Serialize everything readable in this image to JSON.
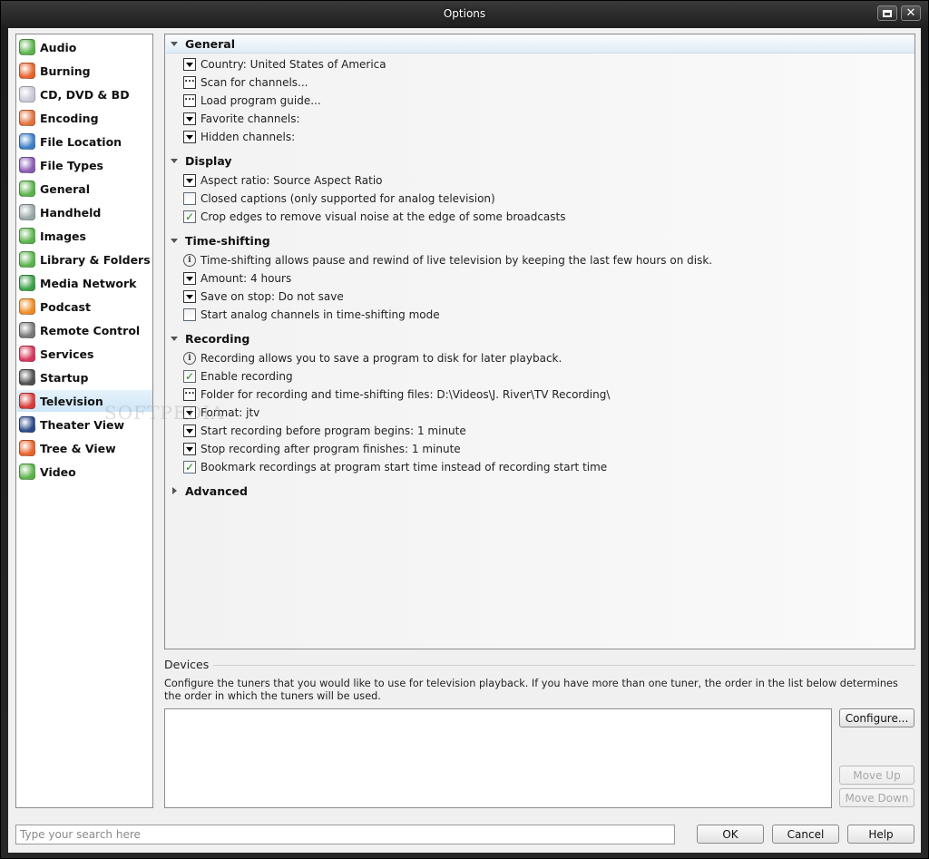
{
  "window": {
    "title": "Options"
  },
  "sidebar": {
    "items": [
      {
        "label": "Audio",
        "icon": "audio-icon",
        "color": "#5ab34a"
      },
      {
        "label": "Burning",
        "icon": "burning-icon",
        "color": "#e8632a"
      },
      {
        "label": "CD, DVD & BD",
        "icon": "disc-icon",
        "color": "#c8c8d8"
      },
      {
        "label": "Encoding",
        "icon": "encoding-icon",
        "color": "#e2703a"
      },
      {
        "label": "File Location",
        "icon": "globe-icon",
        "color": "#3a7fc8"
      },
      {
        "label": "File Types",
        "icon": "puzzle-icon",
        "color": "#8a5bb8"
      },
      {
        "label": "General",
        "icon": "general-icon",
        "color": "#5ab34a"
      },
      {
        "label": "Handheld",
        "icon": "handheld-icon",
        "color": "#9aa6a8"
      },
      {
        "label": "Images",
        "icon": "images-icon",
        "color": "#5ab34a"
      },
      {
        "label": "Library & Folders",
        "icon": "library-icon",
        "color": "#5ab34a"
      },
      {
        "label": "Media Network",
        "icon": "network-icon",
        "color": "#3aa048"
      },
      {
        "label": "Podcast",
        "icon": "rss-icon",
        "color": "#f08a24"
      },
      {
        "label": "Remote Control",
        "icon": "remote-icon",
        "color": "#777777"
      },
      {
        "label": "Services",
        "icon": "services-icon",
        "color": "#d8365a"
      },
      {
        "label": "Startup",
        "icon": "startup-icon",
        "color": "#505050"
      },
      {
        "label": "Television",
        "icon": "television-icon",
        "color": "#d83a3a",
        "active": true
      },
      {
        "label": "Theater View",
        "icon": "theater-icon",
        "color": "#2a4a8a"
      },
      {
        "label": "Tree & View",
        "icon": "tree-icon",
        "color": "#e8632a"
      },
      {
        "label": "Video",
        "icon": "video-icon",
        "color": "#5ab34a"
      }
    ]
  },
  "groups": [
    {
      "label": "General",
      "expanded": true,
      "options": [
        {
          "type": "dropdown",
          "label": "Country: United States of America"
        },
        {
          "type": "dots",
          "label": "Scan for channels..."
        },
        {
          "type": "dots",
          "label": "Load program guide..."
        },
        {
          "type": "dropdown",
          "label": "Favorite channels:"
        },
        {
          "type": "dropdown",
          "label": "Hidden channels:"
        }
      ]
    },
    {
      "label": "Display",
      "expanded": true,
      "options": [
        {
          "type": "dropdown",
          "label": "Aspect ratio: Source Aspect Ratio"
        },
        {
          "type": "checkbox",
          "checked": false,
          "label": "Closed captions (only supported for analog television)"
        },
        {
          "type": "checkbox",
          "checked": true,
          "label": "Crop edges to remove visual noise at the edge of some broadcasts"
        }
      ]
    },
    {
      "label": "Time-shifting",
      "expanded": true,
      "options": [
        {
          "type": "info",
          "label": "Time-shifting allows pause and rewind of live television by keeping the last few hours on disk."
        },
        {
          "type": "dropdown",
          "label": "Amount: 4 hours"
        },
        {
          "type": "dropdown",
          "label": "Save on stop: Do not save"
        },
        {
          "type": "checkbox",
          "checked": false,
          "label": "Start analog channels in time-shifting mode"
        }
      ]
    },
    {
      "label": "Recording",
      "expanded": true,
      "options": [
        {
          "type": "info",
          "label": "Recording allows you to save a program to disk for later playback."
        },
        {
          "type": "checkbox",
          "checked": true,
          "label": "Enable recording"
        },
        {
          "type": "dots",
          "label": "Folder for recording and time-shifting files: D:\\Videos\\J. River\\TV Recording\\"
        },
        {
          "type": "dropdown",
          "label": "Format: jtv"
        },
        {
          "type": "dropdown",
          "label": "Start recording before program begins: 1 minute"
        },
        {
          "type": "dropdown",
          "label": "Stop recording after program finishes: 1 minute"
        },
        {
          "type": "checkbox",
          "checked": true,
          "label": "Bookmark recordings at program start time instead of recording start time"
        }
      ]
    },
    {
      "label": "Advanced",
      "expanded": false,
      "options": []
    }
  ],
  "devices": {
    "title": "Devices",
    "description": "Configure the tuners that you would like to use for television playback.  If you have more than one tuner, the order in the list below determines the order in which the tuners will be used.",
    "configure_label": "Configure...",
    "move_up_label": "Move Up",
    "move_down_label": "Move Down"
  },
  "footer": {
    "search_placeholder": "Type your search here",
    "ok_label": "OK",
    "cancel_label": "Cancel",
    "help_label": "Help"
  },
  "watermark": "SOFTPEDIA"
}
